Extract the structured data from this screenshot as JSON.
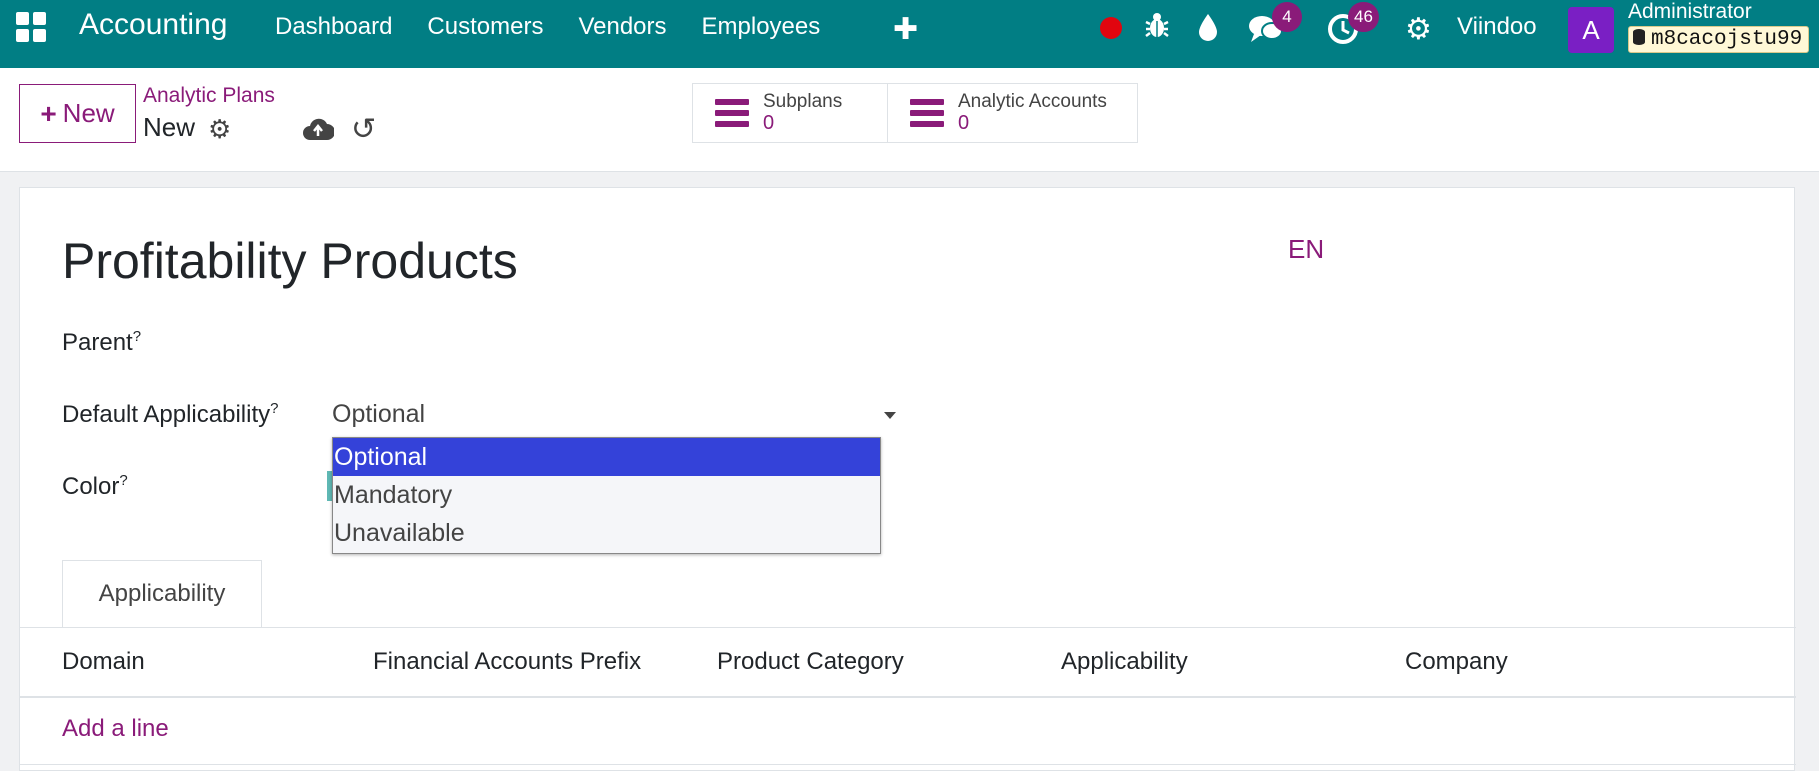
{
  "navbar": {
    "app_name": "Accounting",
    "menu": [
      "Dashboard",
      "Customers",
      "Vendors",
      "Employees"
    ],
    "messages_count": "4",
    "activities_count": "46",
    "company": "Viindoo",
    "avatar_letter": "A",
    "user": "Administrator",
    "database": "m8cacojstu99",
    "accent": "#017e84"
  },
  "control": {
    "new_label": "New",
    "breadcrumb": "Analytic Plans",
    "record": "New",
    "smart_buttons": [
      {
        "label": "Subplans",
        "count": "0"
      },
      {
        "label": "Analytic Accounts",
        "count": "0"
      }
    ]
  },
  "form": {
    "title": "Profitability Products",
    "language": "EN",
    "fields": {
      "parent": "Parent",
      "default_applicability": "Default Applicability",
      "color": "Color"
    },
    "help_mark": "?",
    "applicability_value": "Optional",
    "dropdown_options": [
      "Optional",
      "Mandatory",
      "Unavailable"
    ],
    "tab": "Applicability",
    "columns": [
      "Domain",
      "Financial Accounts Prefix",
      "Product Category",
      "Applicability",
      "Company"
    ],
    "add_line": "Add a line"
  }
}
